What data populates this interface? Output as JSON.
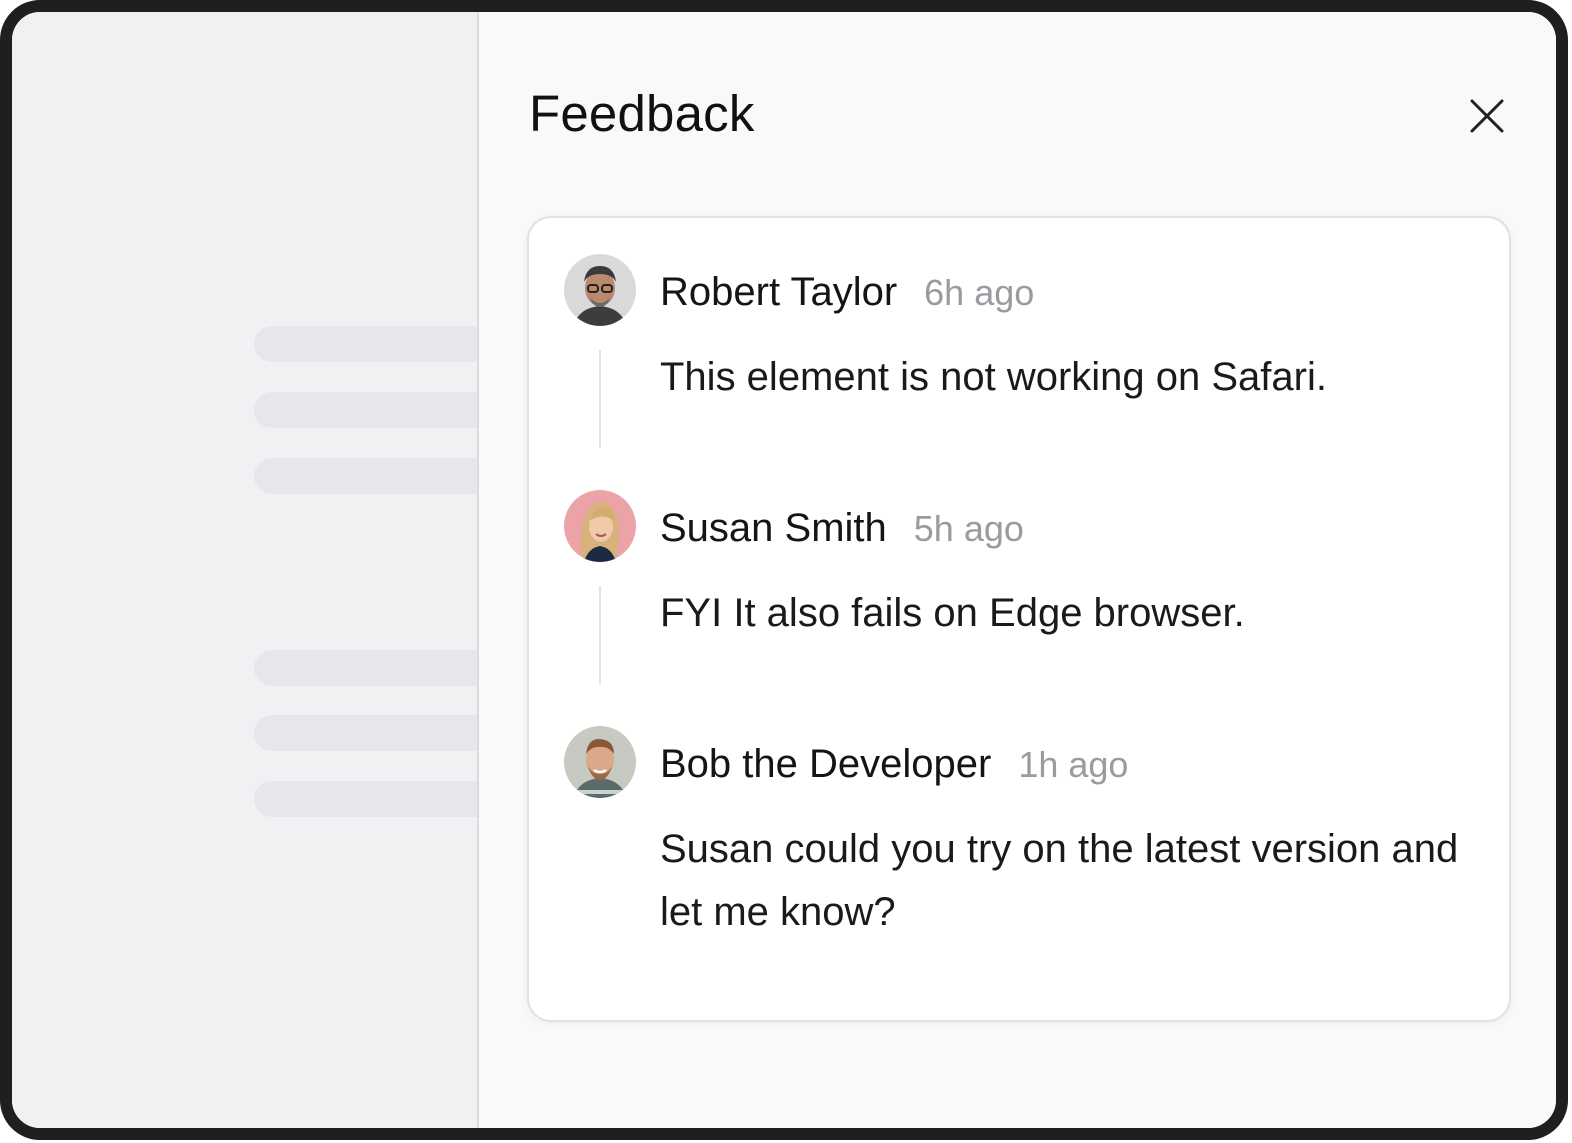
{
  "panel": {
    "title": "Feedback",
    "close_icon": "close-icon"
  },
  "comments": [
    {
      "author": "Robert Taylor",
      "time": "6h ago",
      "text": "This element is not working on Safari.",
      "avatar": "avatar-robert-taylor"
    },
    {
      "author": "Susan Smith",
      "time": "5h ago",
      "text": "FYI It also fails on Edge browser.",
      "avatar": "avatar-susan-smith"
    },
    {
      "author": "Bob the Developer",
      "time": "1h ago",
      "text": "Susan could you try on the latest version and let me know?",
      "avatar": "avatar-bob-the-developer"
    }
  ],
  "colors": {
    "panel_bg": "#f9f9fa",
    "page_bg": "#f1f1f4",
    "skeleton": "#e6e6eb",
    "text": "#151515",
    "muted": "#9a9a9f",
    "frame": "#1f1f1f"
  }
}
